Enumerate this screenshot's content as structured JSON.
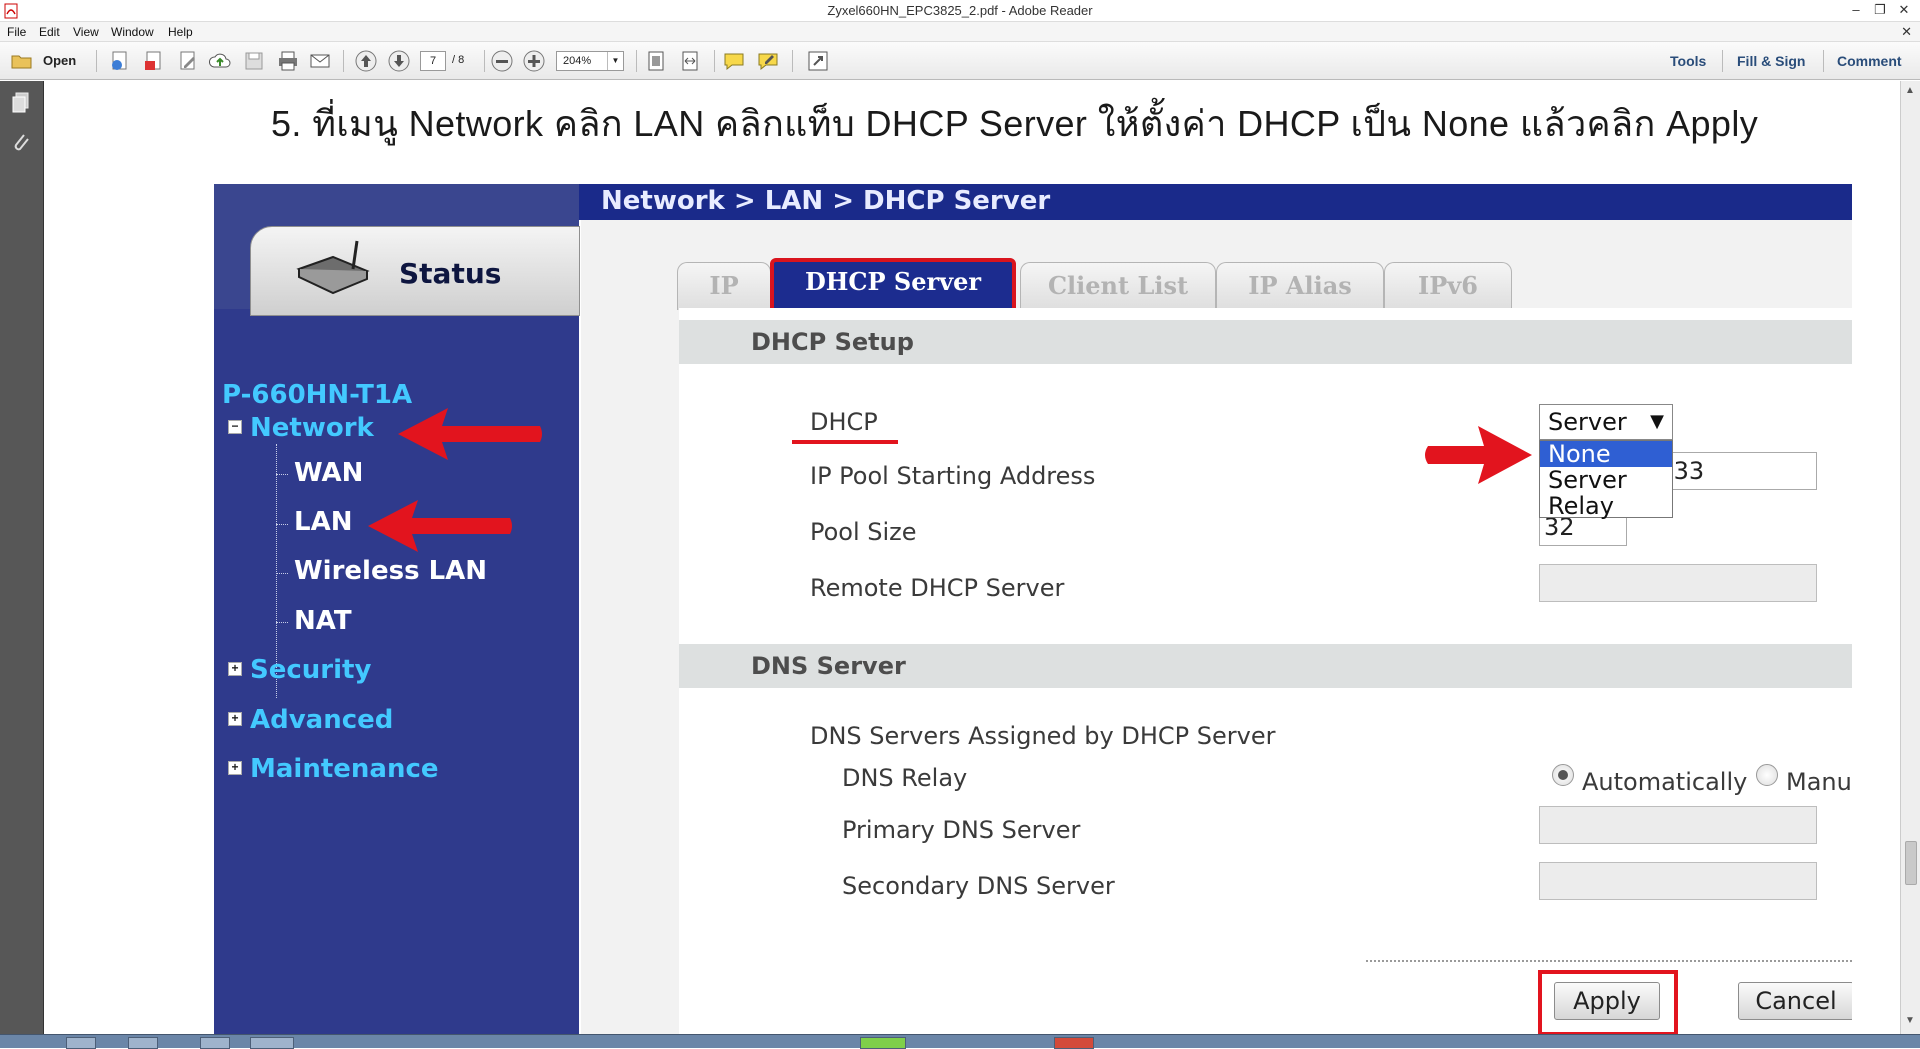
{
  "window": {
    "title": "Zyxel660HN_EPC3825_2.pdf - Adobe Reader",
    "minimize": "–",
    "restore": "❐",
    "close": "✕"
  },
  "menu": {
    "items": [
      "File",
      "Edit",
      "View",
      "Window",
      "Help"
    ],
    "close_doc": "✕"
  },
  "toolbar": {
    "open_label": "Open",
    "page_current": "7",
    "page_total": "/ 8",
    "zoom": "204%",
    "tools": "Tools",
    "fill_sign": "Fill & Sign",
    "comment": "Comment"
  },
  "document": {
    "instruction": "5.   ที่เมนู Network คลิก LAN คลิกแท็บ DHCP Server ให้ตั้งค่า DHCP เป็น None แล้วคลิก Apply"
  },
  "router": {
    "breadcrumb": "Network > LAN > DHCP Server",
    "status_tab": "Status",
    "model": "P-660HN-T1A",
    "nav": {
      "network": "Network",
      "wan": "WAN",
      "lan": "LAN",
      "wireless_lan": "Wireless LAN",
      "nat": "NAT",
      "security": "Security",
      "advanced": "Advanced",
      "maintenance": "Maintenance",
      "expanded_sign": "−",
      "collapsed_sign": "+"
    },
    "tabs": [
      "IP",
      "DHCP Server",
      "Client List",
      "IP Alias",
      "IPv6"
    ],
    "active_tab": "DHCP Server",
    "dhcp_setup": {
      "heading": "DHCP Setup",
      "dhcp_label": "DHCP",
      "dhcp_value": "Server",
      "dropdown_caret": "▼",
      "dropdown_options": [
        "None",
        "Server",
        "Relay"
      ],
      "dropdown_highlighted": "None",
      "ip_pool_label": "IP Pool Starting Address",
      "ip_pool_value": ".33",
      "pool_size_label": "Pool Size",
      "pool_size_value": "32",
      "remote_dhcp_label": "Remote DHCP Server",
      "remote_dhcp_value": ""
    },
    "dns_server": {
      "heading": "DNS Server",
      "assigned_label": "DNS Servers Assigned by DHCP Server",
      "relay_label": "DNS Relay",
      "auto_label": "Automatically",
      "manual_label": "Manually",
      "relay_selected": "Automatically",
      "primary_label": "Primary DNS Server",
      "primary_value": "",
      "secondary_label": "Secondary DNS Server",
      "secondary_value": ""
    },
    "buttons": {
      "apply": "Apply",
      "cancel": "Cancel"
    }
  },
  "colors": {
    "annotation_red": "#e2141e",
    "router_nav_blue": "#2f3a8c",
    "router_link_cyan": "#43c9ff",
    "tab_active_blue": "#1c2c8f",
    "reader_link": "#2a4d7a"
  }
}
